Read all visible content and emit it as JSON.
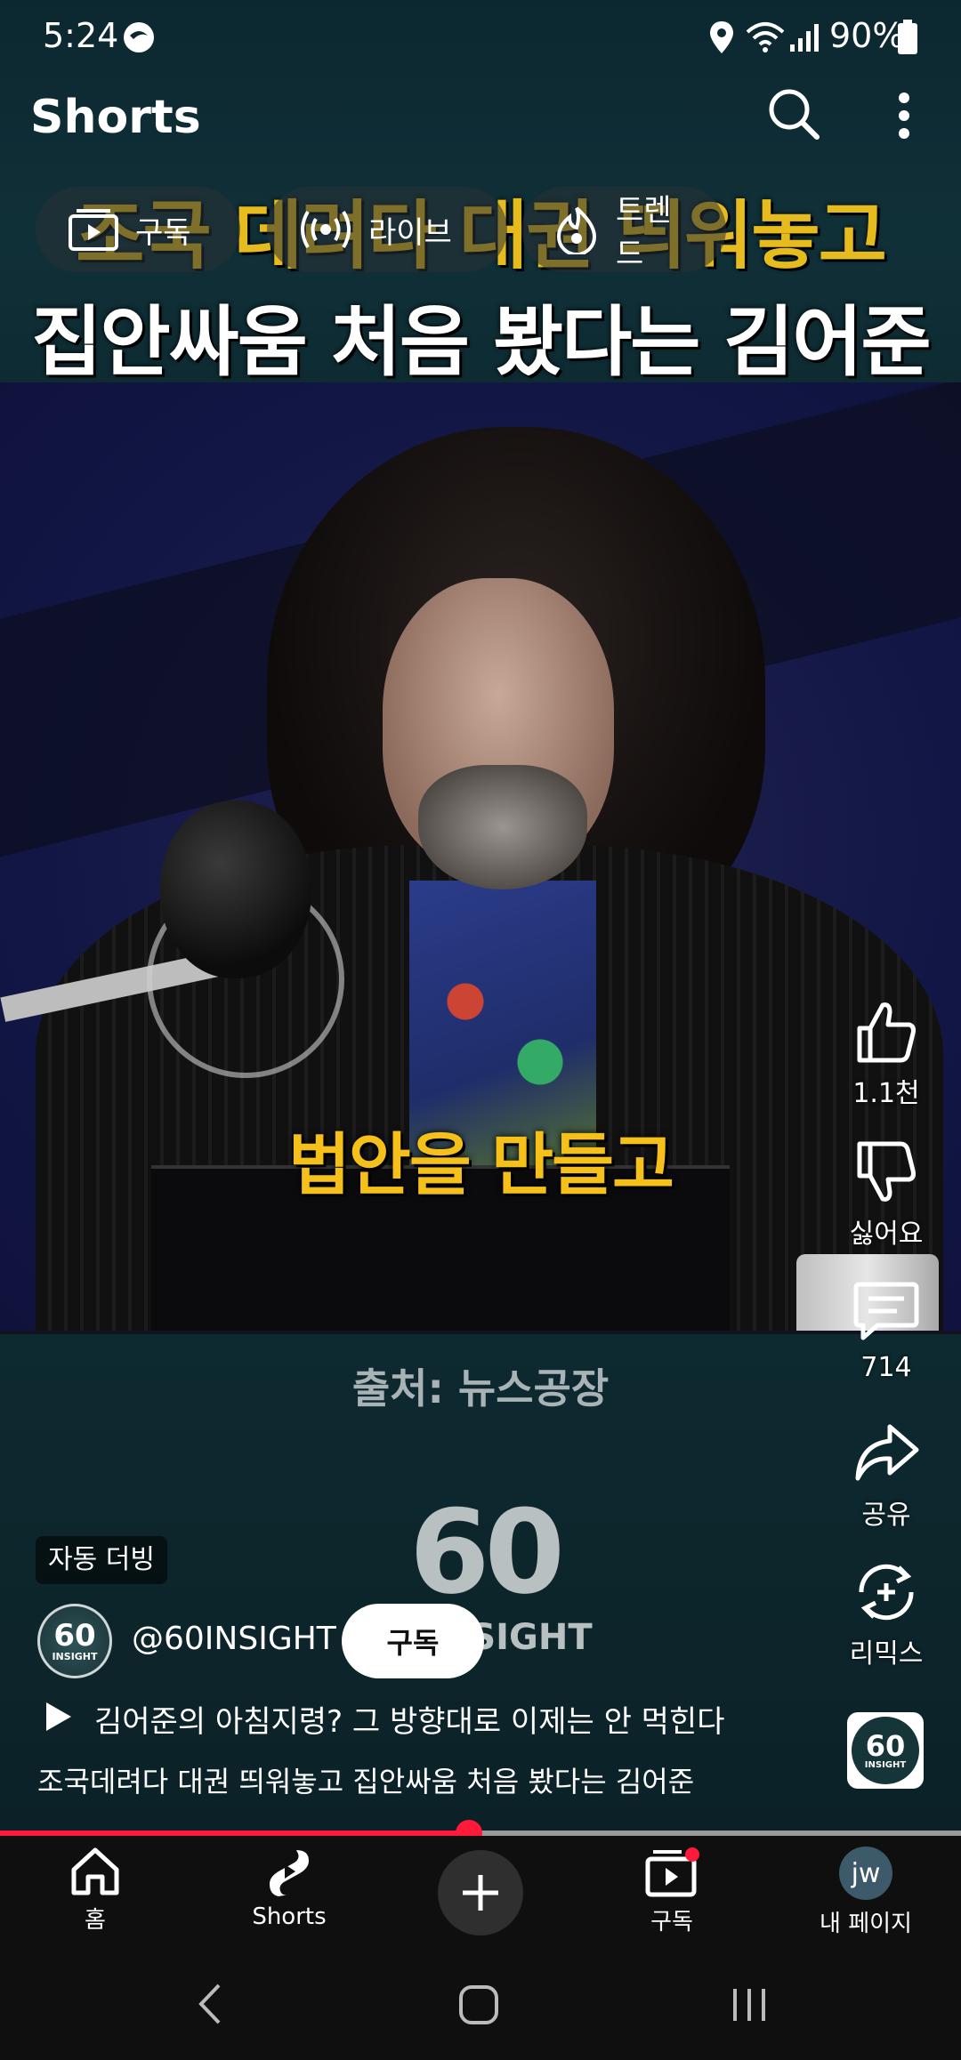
{
  "status_bar": {
    "time": "5:24",
    "battery": "90%"
  },
  "header": {
    "title": "Shorts"
  },
  "chips": [
    {
      "label": "구독",
      "icon": "subscriptions-icon"
    },
    {
      "label": "라이브",
      "icon": "live-icon"
    },
    {
      "label": "트렌드",
      "icon": "trending-icon"
    }
  ],
  "video": {
    "overlay_title_line1": "조국 데려다 대권 띄워놓고",
    "overlay_title_line2": "집안싸움 처음 봤다는 김어준",
    "caption": "법안을 만들고",
    "source": "출처: 뉴스공장",
    "logo_number": "60",
    "logo_word": "INSIGHT",
    "progress_fraction": 0.488
  },
  "actions": {
    "like_count": "1.1천",
    "dislike_label": "싫어요",
    "comment_count": "714",
    "share_label": "공유",
    "remix_label": "리믹스"
  },
  "info": {
    "dub_badge": "자동 더빙",
    "channel_handle": "@60INSIGHT",
    "subscribe_label": "구독",
    "avatar_number": "60",
    "avatar_word": "INSIGHT",
    "title": "김어준의 아침지령? 그 방향대로 이제는 안 먹힌다",
    "description": "조국데려다 대권 띄워놓고 집안싸움 처음 봤다는 김어준"
  },
  "nav": {
    "home": "홈",
    "shorts": "Shorts",
    "subscriptions": "구독",
    "profile_initials": "jw",
    "my_page": "내 페이지"
  }
}
